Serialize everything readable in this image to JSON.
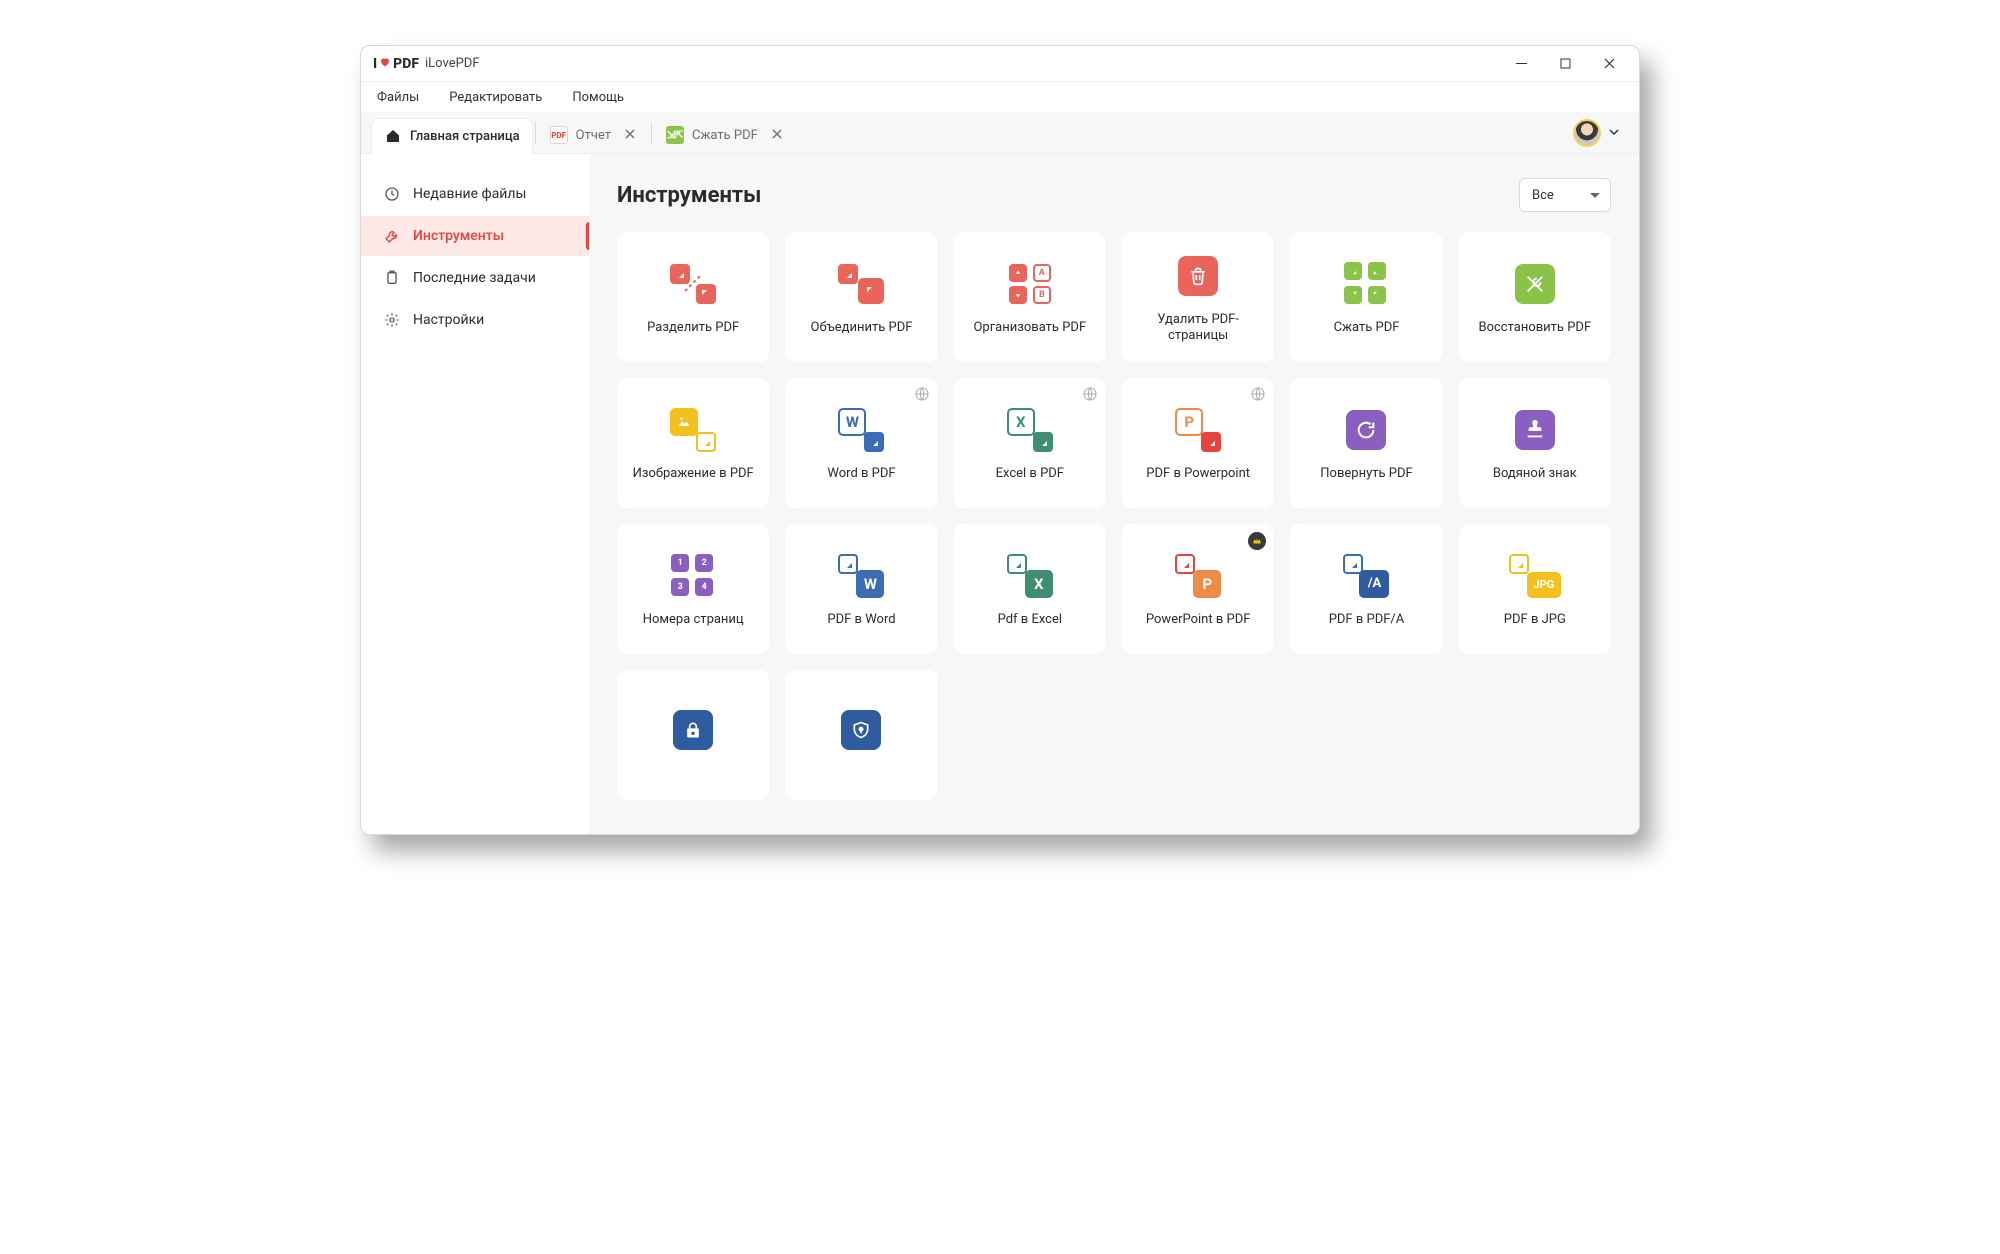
{
  "app": {
    "name": "iLovePDF",
    "logo_text_left": "I",
    "logo_text_right": "PDF"
  },
  "menubar": {
    "files": "Файлы",
    "edit": "Редактировать",
    "help": "Помощь"
  },
  "tabs": [
    {
      "id": "home",
      "label": "Главная страница",
      "active": true
    },
    {
      "id": "report",
      "label": "Отчет",
      "active": false
    },
    {
      "id": "compress",
      "label": "Сжать PDF",
      "active": false
    }
  ],
  "sidebar": {
    "items": [
      {
        "id": "recent",
        "label": "Недавние файлы"
      },
      {
        "id": "tools",
        "label": "Инструменты"
      },
      {
        "id": "tasks",
        "label": "Последние задачи"
      },
      {
        "id": "settings",
        "label": "Настройки"
      }
    ],
    "active": "tools"
  },
  "main": {
    "title": "Инструменты",
    "filter_value": "Все"
  },
  "tools": [
    {
      "id": "split",
      "label": "Разделить PDF"
    },
    {
      "id": "merge",
      "label": "Объединить PDF"
    },
    {
      "id": "organize",
      "label": "Организовать PDF"
    },
    {
      "id": "remove",
      "label": "Удалить PDF-страницы"
    },
    {
      "id": "compress",
      "label": "Сжать PDF"
    },
    {
      "id": "repair",
      "label": "Восстановить PDF"
    },
    {
      "id": "imgtopdf",
      "label": "Изображение в PDF"
    },
    {
      "id": "wordtopdf",
      "label": "Word в PDF",
      "badge": "web"
    },
    {
      "id": "exceltopdf",
      "label": "Excel в PDF",
      "badge": "web"
    },
    {
      "id": "pdftoppt",
      "label": "PDF в Powerpoint",
      "badge": "web"
    },
    {
      "id": "rotate",
      "label": "Повернуть PDF"
    },
    {
      "id": "watermark",
      "label": "Водяной знак"
    },
    {
      "id": "pagenum",
      "label": "Номера страниц"
    },
    {
      "id": "pdftoword",
      "label": "PDF в Word"
    },
    {
      "id": "pdftoexcel",
      "label": "Pdf в Excel"
    },
    {
      "id": "ppttopdf",
      "label": "PowerPoint в PDF",
      "badge": "premium"
    },
    {
      "id": "pdfapdf",
      "label": "PDF в PDF/A"
    },
    {
      "id": "pdftojpg",
      "label": "PDF в JPG"
    },
    {
      "id": "protect",
      "label": ""
    },
    {
      "id": "unlock",
      "label": ""
    }
  ],
  "icon_text": {
    "W": "W",
    "X": "X",
    "P": "P",
    "A": "/A",
    "JPG": "JPG",
    "n1": "1",
    "n2": "2",
    "n3": "3",
    "n4": "4",
    "oA": "A",
    "oB": "B"
  }
}
